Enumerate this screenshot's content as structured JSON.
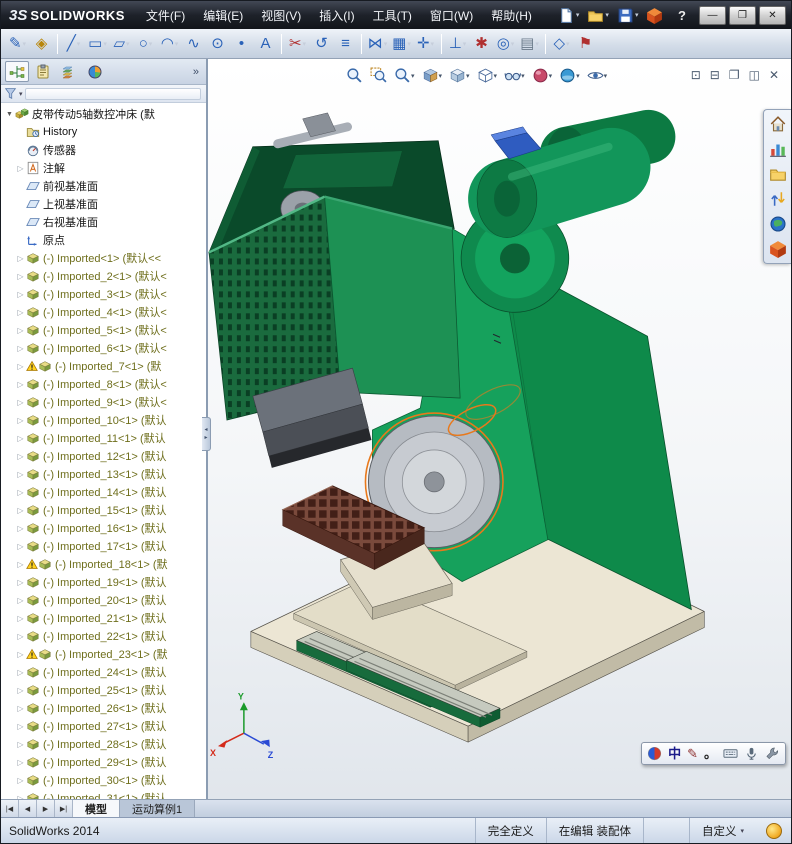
{
  "brand": {
    "mark": "3S",
    "name": "SOLIDWORKS"
  },
  "menus": [
    {
      "name": "menu-file",
      "label": "文件(F)"
    },
    {
      "name": "menu-edit",
      "label": "编辑(E)"
    },
    {
      "name": "menu-view",
      "label": "视图(V)"
    },
    {
      "name": "menu-insert",
      "label": "插入(I)"
    },
    {
      "name": "menu-tools",
      "label": "工具(T)"
    },
    {
      "name": "menu-window",
      "label": "窗口(W)"
    },
    {
      "name": "menu-help",
      "label": "帮助(H)"
    }
  ],
  "quickbar": [
    {
      "name": "new-document-button",
      "sym": "s-doc",
      "dd": true
    },
    {
      "name": "open-document-button",
      "sym": "s-folder",
      "dd": true
    },
    {
      "name": "save-document-button",
      "sym": "s-save",
      "dd": true
    },
    {
      "name": "solidworks-cube-button",
      "sym": "s-redcube",
      "dd": false
    }
  ],
  "titlebar": {
    "help_glyph": "?",
    "minimize": "—",
    "restore": "❐",
    "close": "✕"
  },
  "toolbar2": {
    "items": [
      {
        "name": "sketch-button",
        "glyph": "✎",
        "color": "#2a62b8",
        "dd": true
      },
      {
        "name": "smart-dimension-button",
        "glyph": "◈",
        "color": "#b8860b",
        "dd": false
      },
      {
        "sep": true
      },
      {
        "name": "line-button",
        "glyph": "╱",
        "color": "#2a62b8",
        "dd": true
      },
      {
        "name": "corner-rectangle-button",
        "glyph": "▭",
        "color": "#2a62b8",
        "dd": true
      },
      {
        "name": "straight-slot-button",
        "glyph": "▱",
        "color": "#2a62b8",
        "dd": true
      },
      {
        "name": "circle-button",
        "glyph": "○",
        "color": "#2a62b8",
        "dd": true
      },
      {
        "name": "centerpoint-arc-button",
        "glyph": "◠",
        "color": "#2a62b8",
        "dd": true
      },
      {
        "name": "spline-button",
        "glyph": "∿",
        "color": "#2a62b8",
        "dd": false
      },
      {
        "name": "ellipse-button",
        "glyph": "⊙",
        "color": "#2a62b8",
        "dd": false
      },
      {
        "name": "point-button",
        "glyph": "•",
        "color": "#2a62b8",
        "dd": false
      },
      {
        "name": "text-button",
        "glyph": "A",
        "color": "#2a62b8",
        "dd": false
      },
      {
        "sep": true
      },
      {
        "name": "trim-entities-button",
        "glyph": "✂",
        "color": "#b03030",
        "dd": true
      },
      {
        "name": "convert-entities-button",
        "glyph": "↺",
        "color": "#2a62b8",
        "dd": false
      },
      {
        "name": "offset-entities-button",
        "glyph": "≡",
        "color": "#2a62b8",
        "dd": false
      },
      {
        "sep": true
      },
      {
        "name": "mirror-entities-button",
        "glyph": "⋈",
        "color": "#2a62b8",
        "dd": true
      },
      {
        "name": "linear-pattern-button",
        "glyph": "▦",
        "color": "#2a62b8",
        "dd": true
      },
      {
        "name": "move-entities-button",
        "glyph": "✛",
        "color": "#2a62b8",
        "dd": true
      },
      {
        "sep": true
      },
      {
        "name": "display-relations-button",
        "glyph": "⊥",
        "color": "#2a62b8",
        "dd": true
      },
      {
        "name": "repair-sketch-button",
        "glyph": "✱",
        "color": "#b03030",
        "dd": false
      },
      {
        "name": "quick-snaps-button",
        "glyph": "◎",
        "color": "#2a62b8",
        "dd": true
      },
      {
        "name": "grid-system-button",
        "glyph": "▤",
        "color": "#6a7a8a",
        "dd": true
      },
      {
        "sep": true
      },
      {
        "name": "reference-geometry-button",
        "glyph": "◇",
        "color": "#2a62b8",
        "dd": true
      },
      {
        "name": "rapid-sketch-button",
        "glyph": "⚑",
        "color": "#b03030",
        "dd": false
      }
    ]
  },
  "headsup": {
    "items": [
      {
        "name": "zoom-to-fit-button",
        "sym": "s-zoom",
        "dd": false
      },
      {
        "name": "zoom-to-area-button",
        "sym": "s-zoomarea",
        "dd": false
      },
      {
        "name": "previous-view-button",
        "sym": "s-zoom",
        "dd": true
      },
      {
        "name": "section-view-button",
        "sym": "s-section",
        "dd": true
      },
      {
        "name": "view-orientation-button",
        "sym": "s-viewcube",
        "dd": true
      },
      {
        "name": "display-style-button",
        "sym": "s-dispstyle",
        "dd": true
      },
      {
        "name": "hide-show-items-button",
        "sym": "s-glasses",
        "dd": true
      },
      {
        "name": "edit-appearance-button",
        "sym": "s-sphere-red",
        "dd": true
      },
      {
        "name": "apply-scene-button",
        "sym": "s-sphere-scene",
        "dd": true
      },
      {
        "name": "view-settings-button",
        "sym": "s-eye",
        "dd": true
      }
    ]
  },
  "viewport_controls": [
    {
      "name": "viewport-single-button",
      "glyph": "⊡"
    },
    {
      "name": "viewport-split-horizontal-button",
      "glyph": "⊟"
    },
    {
      "name": "viewport-cascade-button",
      "glyph": "❐"
    },
    {
      "name": "viewport-split-vertical-button",
      "glyph": "◫"
    },
    {
      "name": "close-document-button",
      "glyph": "✕"
    }
  ],
  "panel": {
    "tabs": [
      {
        "name": "featuremanager-tab",
        "sym": "s-ftree",
        "active": true
      },
      {
        "name": "propertymanager-tab",
        "sym": "s-prop",
        "active": false
      },
      {
        "name": "configurationmanager-tab",
        "sym": "s-config",
        "active": false
      },
      {
        "name": "displaymanager-tab",
        "sym": "s-display",
        "active": false
      }
    ],
    "overflow": "»",
    "filter_dd": "▾",
    "tree": [
      {
        "name": "tree-item-root",
        "label": "皮带传动5轴数控冲床 (默",
        "icon": "s-assembly",
        "arrow": "▼",
        "cls": "root"
      },
      {
        "name": "tree-item-history",
        "label": "History",
        "icon": "s-history",
        "arrow": "",
        "cls": "plain"
      },
      {
        "name": "tree-item-sensors",
        "label": "传感器",
        "icon": "s-sensor",
        "arrow": "",
        "cls": "plain"
      },
      {
        "name": "tree-item-annotations",
        "label": "注解",
        "icon": "s-noteA",
        "arrow": "▷",
        "cls": "plain"
      },
      {
        "name": "tree-item-front-plane",
        "label": "前视基准面",
        "icon": "s-plane",
        "arrow": "",
        "cls": "plain"
      },
      {
        "name": "tree-item-top-plane",
        "label": "上视基准面",
        "icon": "s-plane",
        "arrow": "",
        "cls": "plain"
      },
      {
        "name": "tree-item-right-plane",
        "label": "右视基准面",
        "icon": "s-plane",
        "arrow": "",
        "cls": "plain"
      },
      {
        "name": "tree-item-origin",
        "label": "原点",
        "icon": "s-origin",
        "arrow": "",
        "cls": "plain"
      },
      {
        "name": "component-imported-1",
        "label": "(-) Imported<1> (默认<<",
        "icon": "s-part",
        "arrow": "▷",
        "cls": "comp"
      },
      {
        "name": "component-imported-2",
        "label": "(-) Imported_2<1> (默认<",
        "icon": "s-part",
        "arrow": "▷",
        "cls": "comp"
      },
      {
        "name": "component-imported-3",
        "label": "(-) Imported_3<1> (默认<",
        "icon": "s-part",
        "arrow": "▷",
        "cls": "comp"
      },
      {
        "name": "component-imported-4",
        "label": "(-) Imported_4<1> (默认<",
        "icon": "s-part",
        "arrow": "▷",
        "cls": "comp"
      },
      {
        "name": "component-imported-5",
        "label": "(-) Imported_5<1> (默认<",
        "icon": "s-part",
        "arrow": "▷",
        "cls": "comp"
      },
      {
        "name": "component-imported-6",
        "label": "(-) Imported_6<1> (默认<",
        "icon": "s-part",
        "arrow": "▷",
        "cls": "comp"
      },
      {
        "name": "component-imported-7",
        "label": "(-) Imported_7<1> (默",
        "icon": "s-part",
        "arrow": "▷",
        "cls": "comp",
        "warn": true
      },
      {
        "name": "component-imported-8",
        "label": "(-) Imported_8<1> (默认<",
        "icon": "s-part",
        "arrow": "▷",
        "cls": "comp"
      },
      {
        "name": "component-imported-9",
        "label": "(-) Imported_9<1> (默认<",
        "icon": "s-part",
        "arrow": "▷",
        "cls": "comp"
      },
      {
        "name": "component-imported-10",
        "label": "(-) Imported_10<1> (默认",
        "icon": "s-part",
        "arrow": "▷",
        "cls": "comp"
      },
      {
        "name": "component-imported-11",
        "label": "(-) Imported_11<1> (默认",
        "icon": "s-part",
        "arrow": "▷",
        "cls": "comp"
      },
      {
        "name": "component-imported-12",
        "label": "(-) Imported_12<1> (默认",
        "icon": "s-part",
        "arrow": "▷",
        "cls": "comp"
      },
      {
        "name": "component-imported-13",
        "label": "(-) Imported_13<1> (默认",
        "icon": "s-part",
        "arrow": "▷",
        "cls": "comp"
      },
      {
        "name": "component-imported-14",
        "label": "(-) Imported_14<1> (默认",
        "icon": "s-part",
        "arrow": "▷",
        "cls": "comp"
      },
      {
        "name": "component-imported-15",
        "label": "(-) Imported_15<1> (默认",
        "icon": "s-part",
        "arrow": "▷",
        "cls": "comp"
      },
      {
        "name": "component-imported-16",
        "label": "(-) Imported_16<1> (默认",
        "icon": "s-part",
        "arrow": "▷",
        "cls": "comp"
      },
      {
        "name": "component-imported-17",
        "label": "(-) Imported_17<1> (默认",
        "icon": "s-part",
        "arrow": "▷",
        "cls": "comp"
      },
      {
        "name": "component-imported-18",
        "label": "(-) Imported_18<1> (默",
        "icon": "s-part",
        "arrow": "▷",
        "cls": "comp",
        "warn": true
      },
      {
        "name": "component-imported-19",
        "label": "(-) Imported_19<1> (默认",
        "icon": "s-part",
        "arrow": "▷",
        "cls": "comp"
      },
      {
        "name": "component-imported-20",
        "label": "(-) Imported_20<1> (默认",
        "icon": "s-part",
        "arrow": "▷",
        "cls": "comp"
      },
      {
        "name": "component-imported-21",
        "label": "(-) Imported_21<1> (默认",
        "icon": "s-part",
        "arrow": "▷",
        "cls": "comp"
      },
      {
        "name": "component-imported-22",
        "label": "(-) Imported_22<1> (默认",
        "icon": "s-part",
        "arrow": "▷",
        "cls": "comp"
      },
      {
        "name": "component-imported-23",
        "label": "(-) Imported_23<1> (默",
        "icon": "s-part",
        "arrow": "▷",
        "cls": "comp",
        "warn": true
      },
      {
        "name": "component-imported-24",
        "label": "(-) Imported_24<1> (默认",
        "icon": "s-part",
        "arrow": "▷",
        "cls": "comp"
      },
      {
        "name": "component-imported-25",
        "label": "(-) Imported_25<1> (默认",
        "icon": "s-part",
        "arrow": "▷",
        "cls": "comp"
      },
      {
        "name": "component-imported-26",
        "label": "(-) Imported_26<1> (默认",
        "icon": "s-part",
        "arrow": "▷",
        "cls": "comp"
      },
      {
        "name": "component-imported-27",
        "label": "(-) Imported_27<1> (默认",
        "icon": "s-part",
        "arrow": "▷",
        "cls": "comp"
      },
      {
        "name": "component-imported-28",
        "label": "(-) Imported_28<1> (默认",
        "icon": "s-part",
        "arrow": "▷",
        "cls": "comp"
      },
      {
        "name": "component-imported-29",
        "label": "(-) Imported_29<1> (默认",
        "icon": "s-part",
        "arrow": "▷",
        "cls": "comp"
      },
      {
        "name": "component-imported-30",
        "label": "(-) Imported_30<1> (默认",
        "icon": "s-part",
        "arrow": "▷",
        "cls": "comp"
      },
      {
        "name": "component-imported-31",
        "label": "(-) Imported_31<1> (默认",
        "icon": "s-part",
        "arrow": "▷",
        "cls": "comp"
      }
    ]
  },
  "taskpane": [
    {
      "name": "solidworks-resources-tab",
      "sym": "s-home"
    },
    {
      "name": "design-library-tab",
      "sym": "s-chart"
    },
    {
      "name": "file-explorer-tab",
      "sym": "s-folder"
    },
    {
      "name": "view-palette-tab",
      "sym": "s-arrows"
    },
    {
      "name": "appearances-scenes-tab",
      "sym": "s-globe"
    },
    {
      "name": "custom-properties-tab",
      "sym": "s-redcube"
    }
  ],
  "splitter": {
    "left": "◂",
    "right": "▸"
  },
  "sheet_nav": [
    {
      "name": "first-tab-button",
      "glyph": "|◀"
    },
    {
      "name": "previous-tab-button",
      "glyph": "◀"
    },
    {
      "name": "next-tab-button",
      "glyph": "▶"
    },
    {
      "name": "last-tab-button",
      "glyph": "▶|"
    }
  ],
  "model_tabs": [
    {
      "name": "tab-model",
      "label": "模型",
      "active": true
    },
    {
      "name": "tab-motion-study-1",
      "label": "运动算例1",
      "active": false
    }
  ],
  "statusbar": {
    "app": "SolidWorks 2014",
    "fields": [
      {
        "name": "status-fully-defined",
        "label": "完全定义",
        "dd": false
      },
      {
        "name": "status-editing-assembly",
        "label": "在编辑 装配体",
        "dd": false
      },
      {
        "name": "status-empty",
        "label": "",
        "dd": false
      },
      {
        "name": "status-custom",
        "label": "自定义",
        "dd": true
      }
    ]
  },
  "ime": [
    {
      "name": "ime-logo",
      "sym": "s-imelogo"
    },
    {
      "name": "ime-mode-chinese",
      "glyph": "中",
      "color": "#1a1a8a"
    },
    {
      "name": "ime-handwriting",
      "glyph": "✎",
      "color": "#8a2a2a"
    },
    {
      "name": "ime-punctuation",
      "glyph": "。",
      "color": "#222222"
    },
    {
      "name": "ime-soft-keyboard",
      "sym": "s-keyboard"
    },
    {
      "name": "ime-microphone",
      "sym": "s-mic"
    },
    {
      "name": "ime-settings",
      "sym": "s-wrench"
    }
  ],
  "triad": {
    "x": "X",
    "y": "Y",
    "z": "Z"
  }
}
